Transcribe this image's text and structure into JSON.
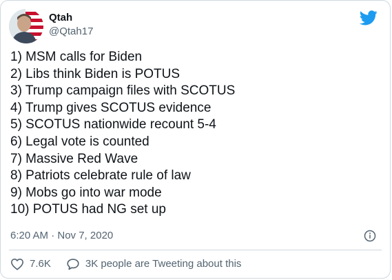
{
  "tweet": {
    "author_name": "Qtah",
    "author_handle": "@Qtah17",
    "lines": [
      "1) MSM calls for Biden",
      "2) Libs think Biden is POTUS",
      "3) Trump campaign files with SCOTUS",
      "4) Trump gives SCOTUS evidence",
      "5) SCOTUS nationwide recount 5-4",
      "6) Legal vote is counted",
      "7) Massive Red Wave",
      "8) Patriots celebrate rule of law",
      "9) Mobs go into war mode",
      "10) POTUS had NG set up"
    ],
    "timestamp": "6:20 AM · Nov 7, 2020",
    "likes": "7.6K",
    "conversation": "3K people are Tweeting about this"
  },
  "icons": {
    "brand": "twitter-bird-icon",
    "info": "info-icon",
    "like": "heart-icon",
    "reply": "speech-bubble-icon"
  },
  "colors": {
    "brand_blue": "#1d9bf0",
    "text": "#0f1419",
    "muted": "#536471",
    "border": "#cfd9de"
  }
}
